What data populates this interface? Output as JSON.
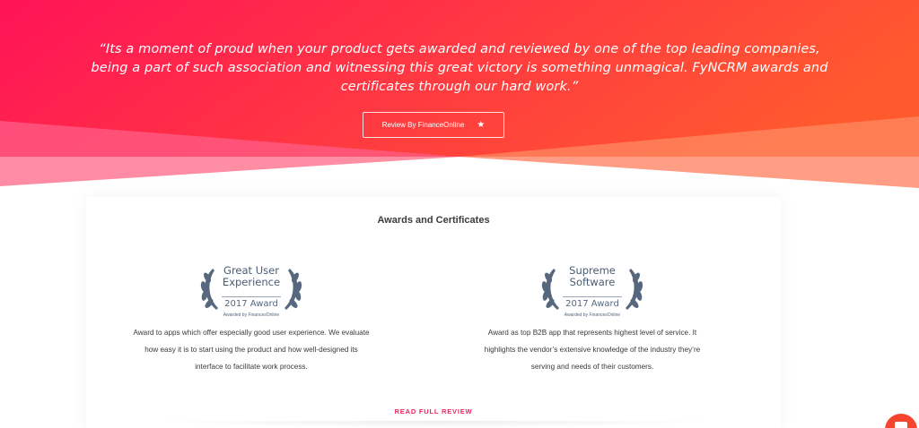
{
  "hero": {
    "quote_line1": "“Its a moment of proud when your product gets awarded and reviewed by one of the top leading companies,",
    "quote_line2": "being a part of such association and witnessing this great victory is something unmagical. FyNCRM awards and",
    "quote_line3": "certificates through our hard work.”",
    "review_button_label": "Review By FinanceOnline",
    "review_button_icon": "star-icon",
    "gradient_start": "#ff1357",
    "gradient_end": "#ff5a2e"
  },
  "awards_section": {
    "title": "Awards and Certificates",
    "awards": [
      {
        "badge_title_line1": "Great User",
        "badge_title_line2": "Experience",
        "badge_year": "2017 Award",
        "badge_by": "Awarded by FinancesOnline",
        "desc_line1": "Award to apps which offer especially good user experience. We evaluate",
        "desc_line2": "how easy it is to start using the product and how well-designed its",
        "desc_line3": "interface to facilitate work process."
      },
      {
        "badge_title_line1": "Supreme",
        "badge_title_line2": "Software",
        "badge_year": "2017 Award",
        "badge_by": "Awarded by FinancesOnline",
        "desc_line1": "Award as top B2B app that represents highest level of service. It",
        "desc_line2": "highlights the vendor’s extensive knowledge of the industry they’re",
        "desc_line3": "serving and needs of their customers."
      }
    ],
    "read_more_label": "READ FULL REVIEW",
    "accent_color": "#f0245e"
  },
  "chat_widget": {
    "icon": "chat-icon"
  }
}
